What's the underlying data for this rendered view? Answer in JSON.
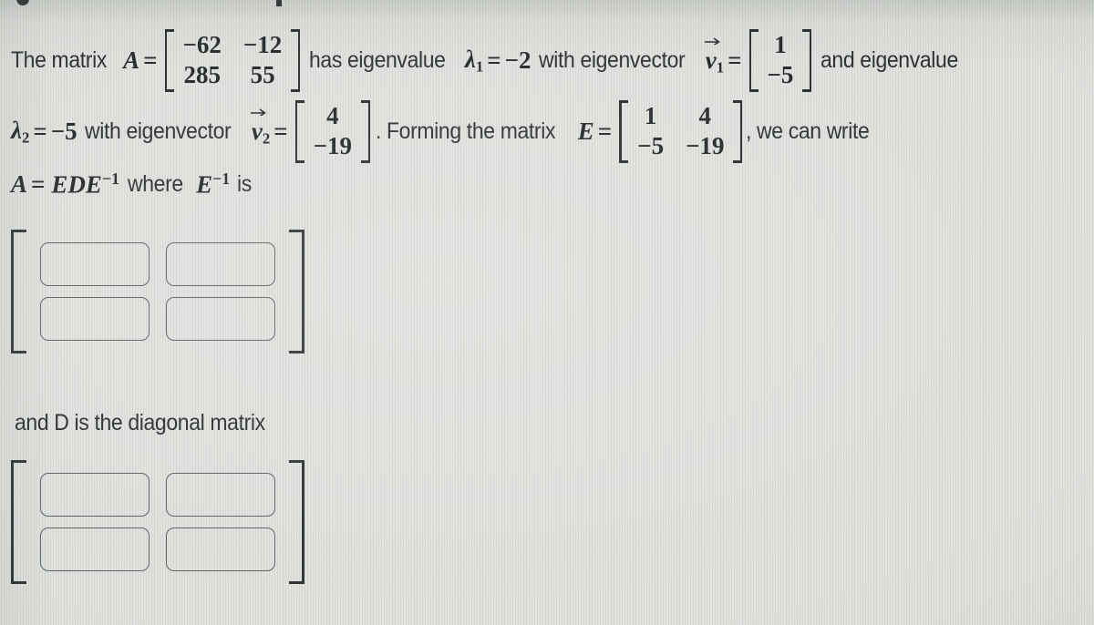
{
  "problem": {
    "line1": {
      "text_before": "The matrix",
      "var_a": "A",
      "eq": "=",
      "matrix_a": {
        "rows": [
          [
            "−62",
            "−12"
          ],
          [
            "285",
            "55"
          ]
        ]
      },
      "text_mid": "has eigenvalue",
      "lambda1_sym": "λ",
      "lambda1_sub": "1",
      "lambda1_value": "−2",
      "text_with": "with eigenvector",
      "v1_sym": "v",
      "v1_sub": "1",
      "vector_v1": {
        "rows": [
          [
            "1"
          ],
          [
            "−5"
          ]
        ]
      },
      "text_after": "and eigenvalue"
    },
    "line2": {
      "lambda2_sym": "λ",
      "lambda2_sub": "2",
      "lambda2_value": "−5",
      "text_with": "with eigenvector",
      "v2_sym": "v",
      "v2_sub": "2",
      "vector_v2": {
        "rows": [
          [
            "4"
          ],
          [
            "−19"
          ]
        ]
      },
      "text_period": ".",
      "text_forming": "Forming the matrix",
      "var_e": "E",
      "matrix_e": {
        "rows": [
          [
            "1",
            "4"
          ],
          [
            "−5",
            "−19"
          ]
        ]
      },
      "text_comma": ",",
      "text_after": "we can write"
    },
    "line3": {
      "var_a": "A",
      "eq": "=",
      "expr_ede": "EDE",
      "expr_exp": "−1",
      "text_where": "where",
      "var_e2": "E",
      "expr_exp2": "−1",
      "text_is": "is"
    },
    "label_d": "and D is the diagonal matrix"
  },
  "answers": {
    "e_inverse": {
      "name": "E-inverse matrix input",
      "cells": [
        "",
        "",
        "",
        ""
      ],
      "placeholders": [
        "",
        "",
        "",
        ""
      ]
    },
    "d_matrix": {
      "name": "D diagonal matrix input",
      "cells": [
        "",
        "",
        "",
        ""
      ],
      "placeholders": [
        "",
        "",
        "",
        ""
      ]
    }
  },
  "colors": {
    "background": "#dfe1dd",
    "text": "#26292c",
    "math": "#1d2023",
    "input_border": "#595f63",
    "bracket": "#2a2d31"
  }
}
